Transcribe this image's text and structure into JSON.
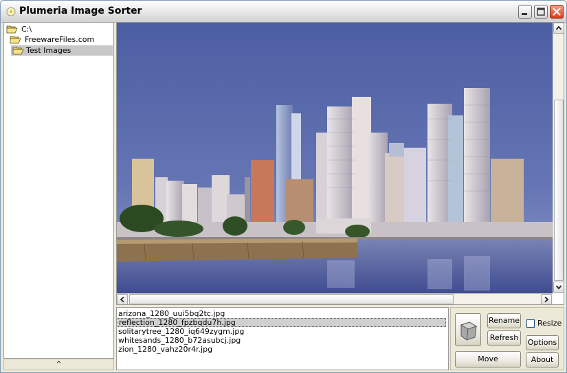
{
  "window": {
    "title": "Plumeria Image Sorter",
    "controls": [
      "minimize-icon",
      "maximize-icon",
      "close-icon"
    ]
  },
  "tree": {
    "items": [
      {
        "label": "C:\\",
        "level": 0,
        "selected": false
      },
      {
        "label": "FreewareFiles.com",
        "level": 1,
        "selected": false
      },
      {
        "label": "Test Images",
        "level": 2,
        "selected": true
      }
    ],
    "splitter_glyph": "^"
  },
  "files": {
    "items": [
      {
        "name": "arizona_1280_uui5bq2tc.jpg",
        "selected": false
      },
      {
        "name": "reflection_1280_fpzbqdu7h.jpg",
        "selected": true
      },
      {
        "name": "solitarytree_1280_iq649zygm.jpg",
        "selected": false
      },
      {
        "name": "whitesands_1280_b72asubcj.jpg",
        "selected": false
      },
      {
        "name": "zion_1280_vahz20r4r.jpg",
        "selected": false
      }
    ]
  },
  "buttons": {
    "rename": "Rename",
    "refresh": "Refresh",
    "move": "Move",
    "options": "Options",
    "about": "About",
    "resize_label": "Resize",
    "resize_checked": false
  },
  "image": {
    "icons": [
      "skyline-photo"
    ]
  },
  "colors": {
    "selection": "#c8c8c8",
    "panel_bg": "#ece9d8",
    "close_button": "#d2401c"
  }
}
